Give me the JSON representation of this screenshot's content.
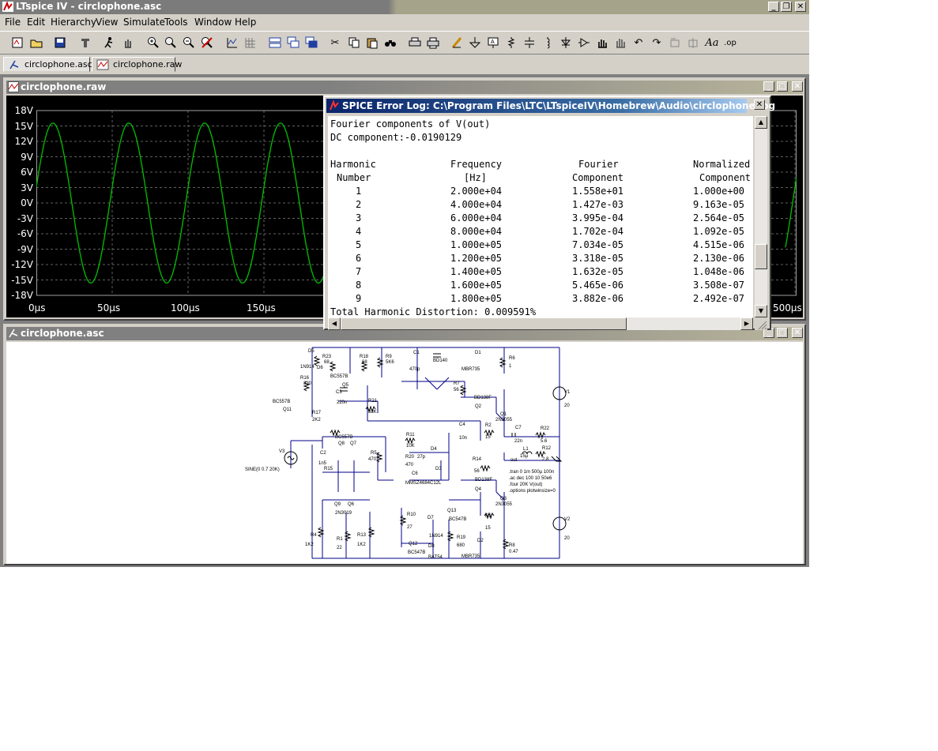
{
  "app": {
    "title": "LTspice IV - circlophone.asc",
    "window_buttons": [
      "_",
      "❐",
      "✕"
    ]
  },
  "menu": [
    "File",
    "Edit",
    "Hierarchy",
    "View",
    "Simulate",
    "Tools",
    "Window",
    "Help"
  ],
  "toolbar_icons": [
    "new-schematic-icon",
    "open-icon",
    "save-icon",
    "control-panel-icon",
    "run-icon",
    "pan-icon",
    "zoom-in-icon",
    "zoom-area-icon",
    "zoom-out-icon",
    "zoom-fit-icon",
    "autorange-icon",
    "grid-icon",
    "tile-horizontal-icon",
    "cascade-icon",
    "tile-vertical-icon",
    "cut-icon",
    "copy-icon",
    "paste-icon",
    "find-icon",
    "print-setup-icon",
    "print-icon",
    "draw-wire-icon",
    "ground-icon",
    "label-net-icon",
    "resistor-icon",
    "capacitor-icon",
    "inductor-icon",
    "diode-icon",
    "component-icon",
    "move-icon",
    "drag-icon",
    "undo-icon",
    "redo-icon",
    "rotate-icon",
    "mirror-icon",
    "text-icon",
    "spice-directive-icon"
  ],
  "tabs": [
    {
      "label": "circlophone.asc",
      "icon": "schematic-tab-icon"
    },
    {
      "label": "circlophone.raw",
      "icon": "waveform-tab-icon"
    }
  ],
  "waveform_window": {
    "title": "circlophone.raw",
    "trace_color": "#00c000"
  },
  "chart_data": {
    "type": "line",
    "title": "",
    "xlabel": "",
    "ylabel": "",
    "x_ticks": [
      "0µs",
      "50µs",
      "100µs",
      "150µs",
      "200µs",
      "500µs"
    ],
    "y_ticks": [
      "18V",
      "15V",
      "12V",
      "9V",
      "6V",
      "3V",
      "0V",
      "-3V",
      "-6V",
      "-9V",
      "-12V",
      "-15V",
      "-18V"
    ],
    "ylim": [
      -18,
      18
    ],
    "grid": true,
    "series": [
      {
        "amplitude_V": 15.58,
        "frequency_Hz": 20000,
        "dc_V": -0.019
      }
    ]
  },
  "schematic_window": {
    "title": "circlophone.asc"
  },
  "schematic": {
    "labels": [
      "D5",
      "R23",
      "68",
      "1N914",
      "D6",
      "R16",
      "330",
      "R18",
      "68",
      "R9",
      "5K6",
      "C1",
      "470p",
      "BD140",
      "D1",
      "MBR735",
      "R6",
      "1",
      "BC557B",
      "Q5",
      "C3",
      "220n",
      "R7",
      "56",
      "BD138F",
      "Q2",
      "Q1",
      "2N3055",
      "V1",
      "20",
      "BC557B",
      "Q11",
      "R17",
      "2K2",
      "R21",
      "33K",
      "R11",
      "10K",
      "C4",
      "10n",
      "R2",
      "15",
      "C7",
      "22n",
      "R22",
      "5.6",
      "BC557B",
      "Q8",
      "Q7",
      "V3",
      "SINE(0 0.7 20K)",
      "C2",
      "1n5",
      "R15",
      "R5",
      "470",
      "R20",
      "470",
      "27p",
      "C6",
      "R14",
      "56",
      "L1",
      "15µ",
      "R12",
      "2.8",
      "out",
      ".tran 0 1m 500µ 100n",
      ".ac dec 100 10 50e6",
      ".four 20K V(out)",
      ".options plotwinsize=0",
      "BD138F",
      "Q4",
      "Q3",
      "2N3055",
      "Q9",
      "Q6",
      "2N3019",
      "R10",
      "27",
      "D7",
      "Q13",
      "BC547B",
      "1N914",
      "R3",
      "15",
      "V2",
      "20",
      "R4",
      "1K2",
      "R1",
      "22",
      "R13",
      "1K2",
      "Q12",
      "BC547B",
      "D8",
      "BAT54",
      "R19",
      "680",
      "D2",
      "MBR735",
      "R8",
      "0.47",
      "D3",
      "MMSZ4684C12L",
      "D4"
    ]
  },
  "error_log": {
    "title": "SPICE Error Log: C:\\Program Files\\LTC\\LTspiceIV\\Homebrew\\Audio\\circlophone.log",
    "line1": "Fourier components of V(out)",
    "line2": "DC component:-0.0190129",
    "headers": [
      "Harmonic",
      "Frequency",
      "Fourier",
      "Normalized"
    ],
    "subheaders": [
      "Number",
      "[Hz]",
      "Component",
      "Component"
    ],
    "rows": [
      [
        "1",
        "2.000e+04",
        "1.558e+01",
        "1.000e+00"
      ],
      [
        "2",
        "4.000e+04",
        "1.427e-03",
        "9.163e-05"
      ],
      [
        "3",
        "6.000e+04",
        "3.995e-04",
        "2.564e-05"
      ],
      [
        "4",
        "8.000e+04",
        "1.702e-04",
        "1.092e-05"
      ],
      [
        "5",
        "1.000e+05",
        "7.034e-05",
        "4.515e-06"
      ],
      [
        "6",
        "1.200e+05",
        "3.318e-05",
        "2.130e-06"
      ],
      [
        "7",
        "1.400e+05",
        "1.632e-05",
        "1.048e-06"
      ],
      [
        "8",
        "1.600e+05",
        "5.465e-06",
        "3.508e-07"
      ],
      [
        "9",
        "1.800e+05",
        "3.882e-06",
        "2.492e-07"
      ]
    ],
    "thd": "Total Harmonic Distortion: 0.009591%",
    "close": "✕"
  }
}
